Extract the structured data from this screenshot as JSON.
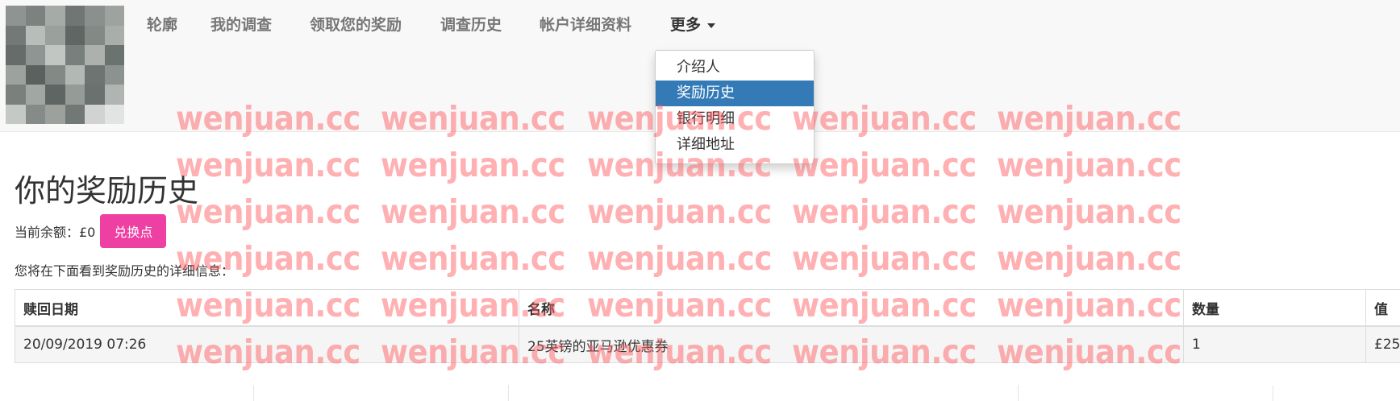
{
  "nav": {
    "items": [
      "轮廓",
      "我的调查",
      "领取您的奖励",
      "调查历史",
      "帐户详细资料"
    ],
    "more_label": "更多"
  },
  "dropdown": {
    "items": [
      "介绍人",
      "奖励历史",
      "银行明细",
      "详细地址"
    ],
    "active_index": 1
  },
  "main": {
    "title": "你的奖励历史",
    "balance_label": "当前余额：£0",
    "redeem_button": "兑换点",
    "info_text": "您将在下面看到奖励历史的详细信息："
  },
  "table": {
    "headers": [
      "赎回日期",
      "名称",
      "数量",
      "值"
    ],
    "rows": [
      [
        "20/09/2019 07:26",
        "25英镑的亚马逊优惠券",
        "1",
        "£25"
      ]
    ]
  },
  "watermark": {
    "text": "wenjuan.cc"
  },
  "colors": {
    "accent": "#ee3fa3",
    "dropdown_active": "#337ab7",
    "watermark": "#ff5a5f",
    "navbar_bg": "#f8f8f8"
  }
}
